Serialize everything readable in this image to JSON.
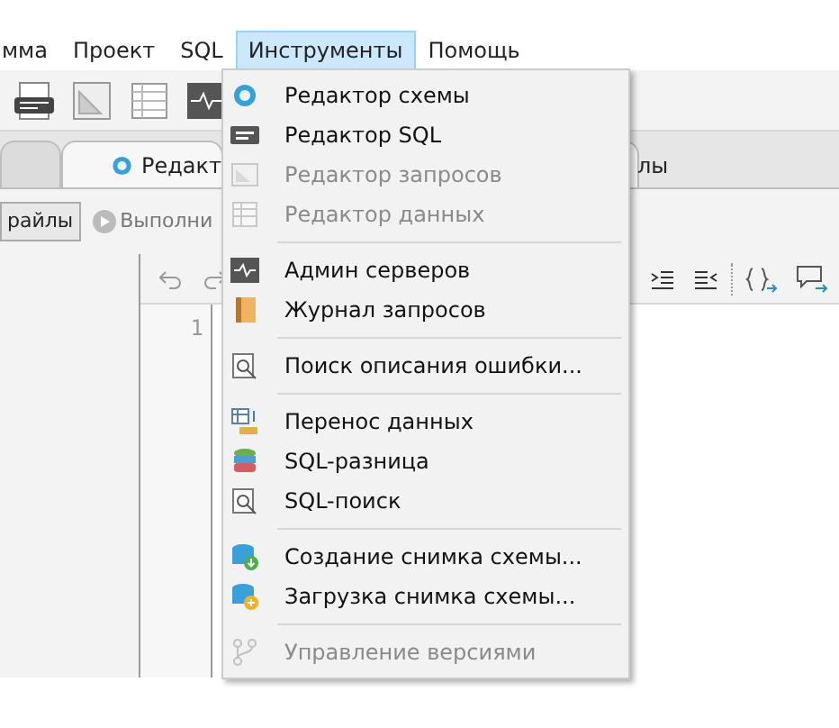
{
  "menubar": [
    {
      "label": "мма",
      "selected": false
    },
    {
      "label": "Проект",
      "selected": false
    },
    {
      "label": "SQL",
      "selected": false
    },
    {
      "label": "Инструменты",
      "selected": true
    },
    {
      "label": "Помощь",
      "selected": false
    }
  ],
  "tabs": [
    {
      "selected": false
    },
    {
      "label": "Редакт",
      "selected": true
    },
    {
      "label": "лы",
      "selected": false
    }
  ],
  "toolbar2": {
    "button": "райлы",
    "run": "Выполни"
  },
  "editor": {
    "line_number": "1"
  },
  "menu": [
    {
      "kind": "item",
      "label": "Редактор схемы",
      "disabled": false
    },
    {
      "kind": "item",
      "label": "Редактор SQL",
      "disabled": false
    },
    {
      "kind": "item",
      "label": "Редактор запросов",
      "disabled": true
    },
    {
      "kind": "item",
      "label": "Редактор данных",
      "disabled": true
    },
    {
      "kind": "separator"
    },
    {
      "kind": "item",
      "label": "Админ серверов",
      "disabled": false
    },
    {
      "kind": "item",
      "label": "Журнал запросов",
      "disabled": false
    },
    {
      "kind": "separator"
    },
    {
      "kind": "item",
      "label": "Поиск описания ошибки...",
      "disabled": false
    },
    {
      "kind": "separator"
    },
    {
      "kind": "item",
      "label": "Перенос данных",
      "disabled": false
    },
    {
      "kind": "item",
      "label": "SQL-разница",
      "disabled": false
    },
    {
      "kind": "item",
      "label": "SQL-поиск",
      "disabled": false
    },
    {
      "kind": "separator"
    },
    {
      "kind": "item",
      "label": "Создание снимка схемы...",
      "disabled": false
    },
    {
      "kind": "item",
      "label": "Загрузка снимка схемы...",
      "disabled": false
    },
    {
      "kind": "separator"
    },
    {
      "kind": "item",
      "label": "Управление версиями",
      "disabled": true
    }
  ]
}
